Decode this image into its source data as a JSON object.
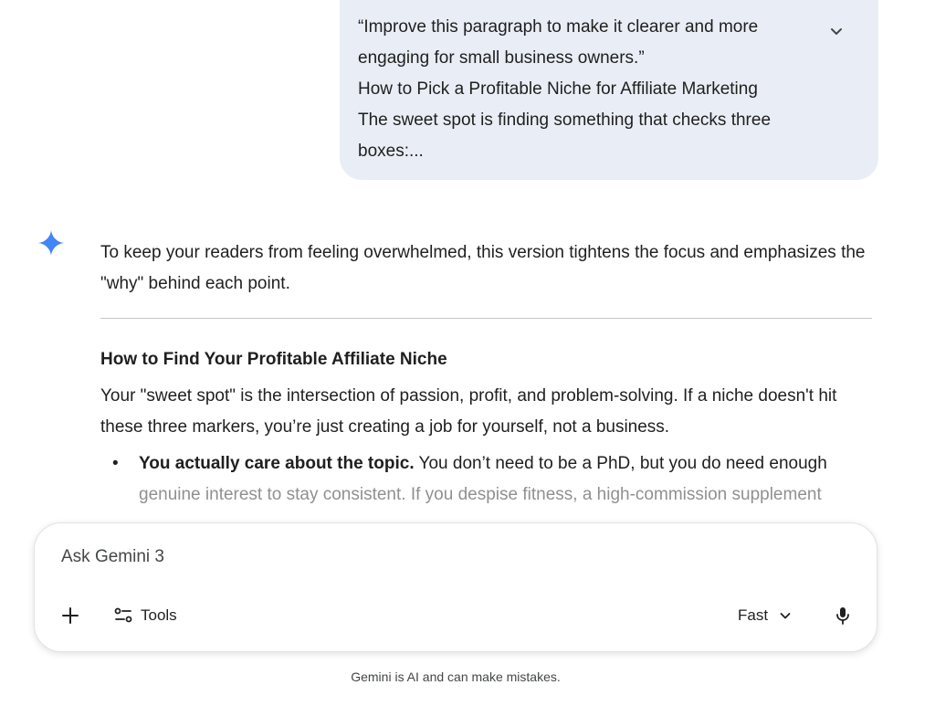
{
  "user_message": {
    "lines": [
      "“Improve this paragraph to make it clearer and more",
      "engaging for small business owners.”",
      "How to Pick a Profitable Niche for Affiliate Marketing",
      "The sweet spot is finding something that checks three",
      "boxes:..."
    ],
    "expand_icon": "chevron-down-icon"
  },
  "response": {
    "intro": "To keep your readers from feeling overwhelmed, this version tightens the focus and emphasizes the \"why\" behind each point.",
    "heading": "How to Find Your Profitable Affiliate Niche",
    "paragraph": "Your \"sweet spot\" is the intersection of passion, profit, and problem-solving. If a niche doesn't hit these three markers, you’re just creating a job for yourself, not a business.",
    "bullets": [
      {
        "bold": "You actually care about the topic.",
        "text_line1": " You don’t need to be a PhD, but you do need enough",
        "text_line2": "genuine interest to stay consistent. If you despise fitness, a high-commission supplement"
      }
    ]
  },
  "input": {
    "placeholder": "Ask Gemini 3",
    "tools_label": "Tools",
    "mode_label": "Fast"
  },
  "footer": {
    "disclaimer": "Gemini is AI and can make mistakes."
  },
  "colors": {
    "accent_blue": "#4285f4",
    "bubble_bg": "#e9eef6"
  }
}
